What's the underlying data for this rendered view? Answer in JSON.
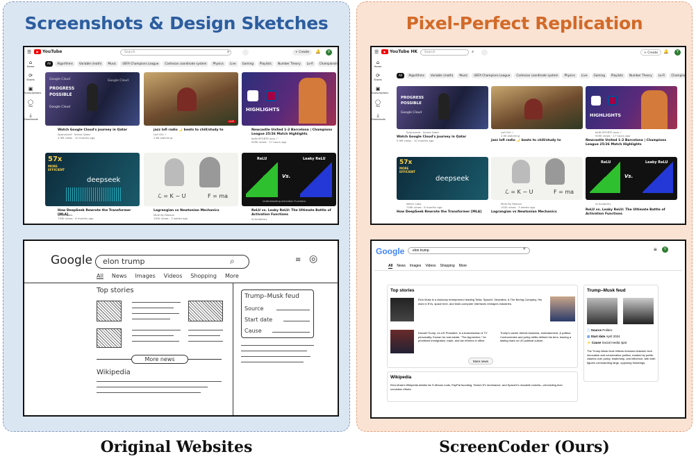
{
  "left_title": "Screenshots & Design Sketches",
  "right_title": "Pixel-Perfect Replication",
  "left_caption": "Original Websites",
  "right_caption": "ScreenCoder (Ours)",
  "yt_left": {
    "logo": "YouTube",
    "search": "Search",
    "create": "+ Create",
    "avatar": "V",
    "chips": [
      "All",
      "Algorithms",
      "Variable (math)",
      "Music",
      "UEFA Champions League",
      "Cartesian coordinate system",
      "Physics",
      "Live",
      "Gaming",
      "Playlists",
      "Number Theory",
      "Lo-fi",
      "Championships"
    ],
    "sidebar": [
      "Home",
      "Shorts",
      "Subscriptions",
      "You",
      "Downloads"
    ],
    "videos": [
      {
        "title": "Watch Google Cloud's journey in Qatar",
        "m1": "Sponsored · Invest Qatar",
        "m2": "5.9M views · 10 months ago",
        "dur": "0:30"
      },
      {
        "title": "jazz lofi radio 🌙 beats to chill/study to",
        "m1": "Lofi Girl ✓",
        "m2": "2.6K watching",
        "dur": "LIVE"
      },
      {
        "title": "Newcastle United 1-2 Barcelona | Champions League 25/26 Match Highlights",
        "m1": "beIN SPORTS Asia ✓",
        "m2": "929K views · 17 hours ago",
        "dur": "7:33"
      },
      {
        "title": "How DeepSeek Rewrote the Transformer [MLA]",
        "m1": "Welch Labs",
        "m2": "749K views · 6 months ago",
        "dur": "18:09"
      },
      {
        "title": "Lagrangian vs Newtonian Mechanics",
        "m1": "Mole By Reason",
        "m2": "192K views · 3 weeks ago",
        "dur": "8:44"
      },
      {
        "title": "ReLU vs. Leaky ReLU: The Ultimate Battle of Activation Functions",
        "m1": "AI Academy",
        "m2": "",
        "dur": "14:08"
      }
    ]
  },
  "yt_right": {
    "logo": "YouTube HK",
    "search": "Search",
    "create": "+ Create",
    "avatar": "Y",
    "chips": [
      "All",
      "Algorithms",
      "Variable (math)",
      "Music",
      "UEFA Champions League",
      "Cartesian coordinate system",
      "Physics",
      "Live",
      "Gaming",
      "Playlists",
      "Number Theory",
      "Lo-Fi",
      "Championships"
    ],
    "sidebar": [
      "Home",
      "Shorts",
      "Subscriptions",
      "You",
      "Downloads"
    ],
    "videos": [
      {
        "title": "Watch Google Cloud's journey in Qatar",
        "m1": "Sponsored · Invest Qatar",
        "m2": "5.9M views · 10 months ago",
        "dur": "0:30"
      },
      {
        "title": "jazz lofi radio 🌙 beats to chill/study to",
        "m1": "Lofi Girl ✓",
        "m2": "2.5K watching",
        "dur": "LIVE"
      },
      {
        "title": "Newcastle United 1-2 Barcelona | Champions League 25/26 Match Highlights",
        "m1": "beIN SPORTS Asia ✓",
        "m2": "929K views · 17 hours ago",
        "dur": "7:33"
      },
      {
        "title": "How DeepSeek Rewrote the Transformer [MLA]",
        "m1": "Welch Labs",
        "m2": "749K views · 6 months ago",
        "dur": "18:09"
      },
      {
        "title": "Lagrangian vs Newtonian Mechanics",
        "m1": "Mole By Reason",
        "m2": "192K views · 3 weeks ago",
        "dur": "8:44"
      },
      {
        "title": "ReLU vs. Leaky ReLU: The Ultimate Battle of Activation Functions",
        "m1": "AI Academy",
        "m2": "",
        "dur": "14:08"
      }
    ]
  },
  "thumbs": {
    "gc": [
      "Google Cloud",
      "PROGRESS",
      "POSSIBLE",
      "Google Cloud",
      "Google Cloud"
    ],
    "nc": "HIGHLIGHTS",
    "ds": [
      "57x",
      "MORE",
      "EFFICIENT",
      "deepseek"
    ],
    "lg": "ℒ = K − U",
    "lg2": "F = ma",
    "relu": [
      "ReLU",
      "Leaky ReLU",
      "Vs.",
      "Understanding Activation Functions"
    ]
  },
  "sketch": {
    "logo": "Google",
    "query": "elon trump",
    "tabs": [
      "All",
      "News",
      "Images",
      "Videos",
      "Shopping",
      "More"
    ],
    "top_stories": "Top stories",
    "more_news": "More news",
    "wikipedia": "Wikipedia",
    "kp_title": "Trump–Musk feud",
    "kp_rows": [
      "Source",
      "Start date",
      "Cause"
    ]
  },
  "gsr": {
    "logo": "Google",
    "query": "elon trump",
    "tabs": [
      "All",
      "News",
      "Images",
      "Videos",
      "Shopping",
      "More"
    ],
    "top_stories": "Top stories",
    "story1": "Elon Musk is a visionary entrepreneur leading Tesla, SpaceX, Neuralink, & The Boring Company. His work in EVs, space tech, and brain-computer interfaces reshapes industries.",
    "story2": "Donald Trump, ex-US President, is a businessman & TV personality. Known for real estate, \"The Apprentice,\" he prioritized immigration, trade, and tax reforms in office.",
    "story3": "Trump's career blends business, entertainment, & politics. Controversies and policy shifts defined his term, leaving a lasting mark on US political culture.",
    "more_news": "More news",
    "wikipedia": "Wikipedia",
    "wiki_text": "Elon Musk's Wikipedia details his S African roots, PayPal founding, Tesla's EV dominance, and SpaceX's reusable rockets—chronicling tech revolution efforts.",
    "kp_title": "Trump–Musk feud",
    "kp_rows": [
      {
        "k": "Source",
        "v": "Politics"
      },
      {
        "k": "Start date",
        "v": "April 2024"
      },
      {
        "k": "Cause",
        "v": "Social media spat"
      }
    ],
    "kp_text": "The Trump-Musk feud reflects tensions between tech innovation and conservative politics, marked by public clashes over policy, leadership, and influence, with both figures commanding large, opposing followings.",
    "avatar": "V"
  },
  "colors": {
    "left_bg": "#dbe6f3",
    "right_bg": "#fbe3d4",
    "left_title": "#2c5d9e",
    "right_title": "#d26a28",
    "yt_red": "#ee0000"
  }
}
